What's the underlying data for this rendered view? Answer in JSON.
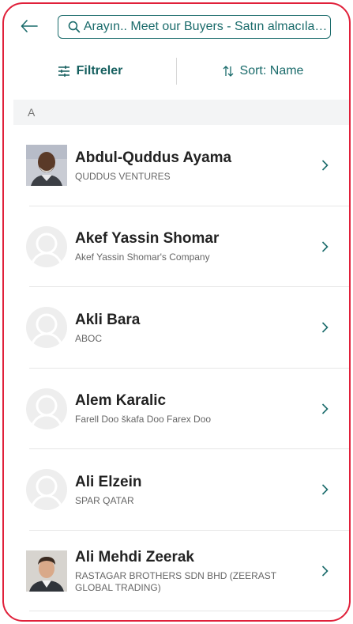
{
  "search": {
    "text": "Arayın.. Meet our Buyers - Satın almacıları..."
  },
  "toolbar": {
    "filter_label": "Filtreler",
    "sort_label": "Sort: Name"
  },
  "section": {
    "letter": "A"
  },
  "buyers": [
    {
      "name": "Abdul-Quddus Ayama",
      "company": "QUDDUS VENTURES"
    },
    {
      "name": "Akef Yassin Shomar",
      "company": "Akef Yassin Shomar's Company"
    },
    {
      "name": "Akli Bara",
      "company": "ABOC"
    },
    {
      "name": "Alem Karalic",
      "company": "Farell Doo škafa Doo Farex Doo"
    },
    {
      "name": "Ali Elzein",
      "company": "SPAR QATAR"
    },
    {
      "name": "Ali Mehdi Zeerak",
      "company": "RASTAGAR BROTHERS SDN BHD (ZEERAST GLOBAL TRADING)"
    }
  ],
  "colors": {
    "accent": "#1a6b6b",
    "frame": "#e0203a"
  }
}
